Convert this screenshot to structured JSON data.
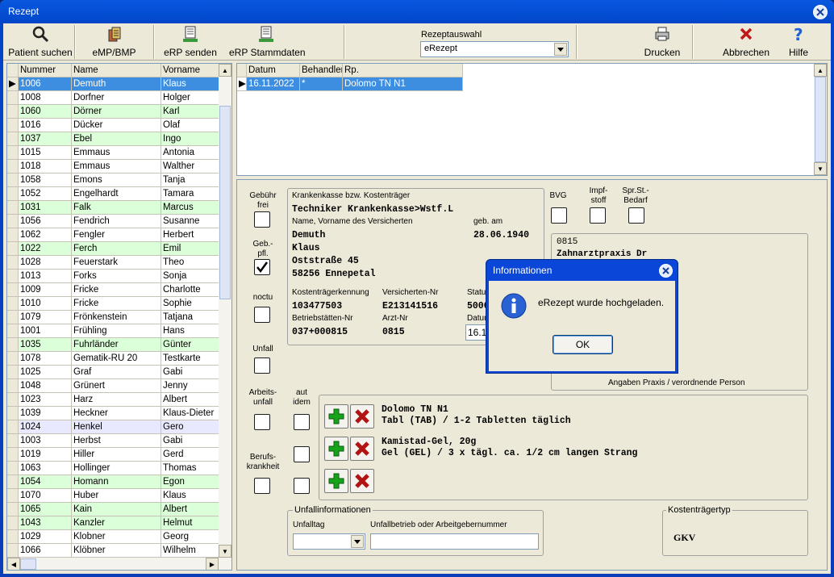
{
  "window": {
    "title": "Rezept"
  },
  "toolbar": {
    "patient_suchen": "Patient suchen",
    "emp_bmp": "eMP/BMP",
    "erp_senden": "eRP senden",
    "erp_stammdaten": "eRP Stammdaten",
    "rezeptauswahl_label": "Rezeptauswahl",
    "rezeptauswahl_value": "eRezept",
    "drucken": "Drucken",
    "abbrechen": "Abbrechen",
    "hilfe": "Hilfe"
  },
  "patients": {
    "headers": [
      "Nummer",
      "Name",
      "Vorname"
    ],
    "rows": [
      {
        "nr": "1006",
        "name": "Demuth",
        "vorname": "Klaus",
        "style": "sel"
      },
      {
        "nr": "1008",
        "name": "Dorfner",
        "vorname": "Holger",
        "style": ""
      },
      {
        "nr": "1060",
        "name": "Dörner",
        "vorname": "Karl",
        "style": "green"
      },
      {
        "nr": "1016",
        "name": "Dücker",
        "vorname": "Olaf",
        "style": ""
      },
      {
        "nr": "1037",
        "name": "Ebel",
        "vorname": "Ingo",
        "style": "green"
      },
      {
        "nr": "1015",
        "name": "Emmaus",
        "vorname": "Antonia",
        "style": ""
      },
      {
        "nr": "1018",
        "name": "Emmaus",
        "vorname": "Walther",
        "style": ""
      },
      {
        "nr": "1058",
        "name": "Emons",
        "vorname": "Tanja",
        "style": ""
      },
      {
        "nr": "1052",
        "name": "Engelhardt",
        "vorname": "Tamara",
        "style": ""
      },
      {
        "nr": "1031",
        "name": "Falk",
        "vorname": "Marcus",
        "style": "green"
      },
      {
        "nr": "1056",
        "name": "Fendrich",
        "vorname": "Susanne",
        "style": ""
      },
      {
        "nr": "1062",
        "name": "Fengler",
        "vorname": "Herbert",
        "style": ""
      },
      {
        "nr": "1022",
        "name": "Ferch",
        "vorname": "Emil",
        "style": "green"
      },
      {
        "nr": "1028",
        "name": "Feuerstark",
        "vorname": "Theo",
        "style": ""
      },
      {
        "nr": "1013",
        "name": "Forks",
        "vorname": "Sonja",
        "style": ""
      },
      {
        "nr": "1009",
        "name": "Fricke",
        "vorname": "Charlotte",
        "style": ""
      },
      {
        "nr": "1010",
        "name": "Fricke",
        "vorname": "Sophie",
        "style": ""
      },
      {
        "nr": "1079",
        "name": "Frönkenstein",
        "vorname": "Tatjana",
        "style": ""
      },
      {
        "nr": "1001",
        "name": "Frühling",
        "vorname": "Hans",
        "style": ""
      },
      {
        "nr": "1035",
        "name": "Fuhrländer",
        "vorname": "Günter",
        "style": "green"
      },
      {
        "nr": "1078",
        "name": "Gematik-RU 20",
        "vorname": "Testkarte",
        "style": ""
      },
      {
        "nr": "1025",
        "name": "Graf",
        "vorname": "Gabi",
        "style": ""
      },
      {
        "nr": "1048",
        "name": "Grünert",
        "vorname": "Jenny",
        "style": ""
      },
      {
        "nr": "1023",
        "name": "Harz",
        "vorname": "Albert",
        "style": ""
      },
      {
        "nr": "1039",
        "name": "Heckner",
        "vorname": "Klaus-Dieter",
        "style": ""
      },
      {
        "nr": "1024",
        "name": "Henkel",
        "vorname": "Gero",
        "style": "purple"
      },
      {
        "nr": "1003",
        "name": "Herbst",
        "vorname": "Gabi",
        "style": ""
      },
      {
        "nr": "1019",
        "name": "Hiller",
        "vorname": "Gerd",
        "style": ""
      },
      {
        "nr": "1063",
        "name": "Hollinger",
        "vorname": "Thomas",
        "style": ""
      },
      {
        "nr": "1054",
        "name": "Homann",
        "vorname": "Egon",
        "style": "green"
      },
      {
        "nr": "1070",
        "name": "Huber",
        "vorname": "Klaus",
        "style": ""
      },
      {
        "nr": "1065",
        "name": "Kain",
        "vorname": "Albert",
        "style": "green"
      },
      {
        "nr": "1043",
        "name": "Kanzler",
        "vorname": "Helmut",
        "style": "green"
      },
      {
        "nr": "1029",
        "name": "Klobner",
        "vorname": "Georg",
        "style": ""
      },
      {
        "nr": "1066",
        "name": "Klöbner",
        "vorname": "Wilhelm",
        "style": ""
      }
    ]
  },
  "rezepte": {
    "headers": [
      "Datum",
      "Behandler",
      "Rp."
    ],
    "rows": [
      {
        "datum": "16.11.2022",
        "behandler": "*",
        "rp": "Dolomo TN N1"
      }
    ]
  },
  "form": {
    "gebuehr_frei": "Gebühr frei",
    "geb_pfl": "Geb.- pfl.",
    "noctu": "noctu",
    "unfall": "Unfall",
    "arbeitsunfall": "Arbeits- unfall",
    "aut_idem": "aut idem",
    "berufskrankheit": "Berufs- krankheit",
    "bvg": "BVG",
    "impfstoff": "Impf- stoff",
    "spr_bedarf": "Spr.St.- Bedarf",
    "kasse_label": "Krankenkasse bzw. Kostenträger",
    "kasse_value": "Techniker Krankenkasse>Wstf.L",
    "name_label": "Name, Vorname des Versicherten",
    "gebam_label": "geb. am",
    "name1": "Demuth",
    "gebam_value": "28.06.1940",
    "name2": "Klaus",
    "strasse": "Oststraße 45",
    "ort": "58256  Ennepetal",
    "kt_kennung_label": "Kostenträgerkennung",
    "vers_nr_label": "Versicherten-Nr",
    "status_label": "Status",
    "kt_kennung_value": "103477503",
    "vers_nr_value": "E213141516",
    "status_value": "5000",
    "bsnr_label": "Betriebstätten-Nr",
    "arzt_nr_label": "Arzt-Nr",
    "datum_label": "Datum",
    "bsnr_value": "037+000815",
    "arzt_nr_value": "0815",
    "datum_value": "16.11",
    "praxis_line1": "0815",
    "praxis_line2": "Zahnarztpraxis Dr",
    "praxis_label": "Angaben Praxis / verordnende Person",
    "med1_line1": "Dolomo TN N1",
    "med1_line2": "Tabl (TAB) / 1-2 Tabletten täglich",
    "med2_line1": "Kamistad-Gel, 20g",
    "med2_line2": "Gel (GEL) / 3 x tägl. ca. 1/2 cm langen Strang",
    "unfall_group": "Unfallinformationen",
    "unfalltag_label": "Unfalltag",
    "unfallbetrieb_label": "Unfallbetrieb oder Arbeitgebernummer",
    "kt_typ_group": "Kostenträgertyp",
    "kt_typ_value": "GKV"
  },
  "dialog": {
    "title": "Informationen",
    "message": "eRezept wurde hochgeladen.",
    "ok": "OK"
  }
}
